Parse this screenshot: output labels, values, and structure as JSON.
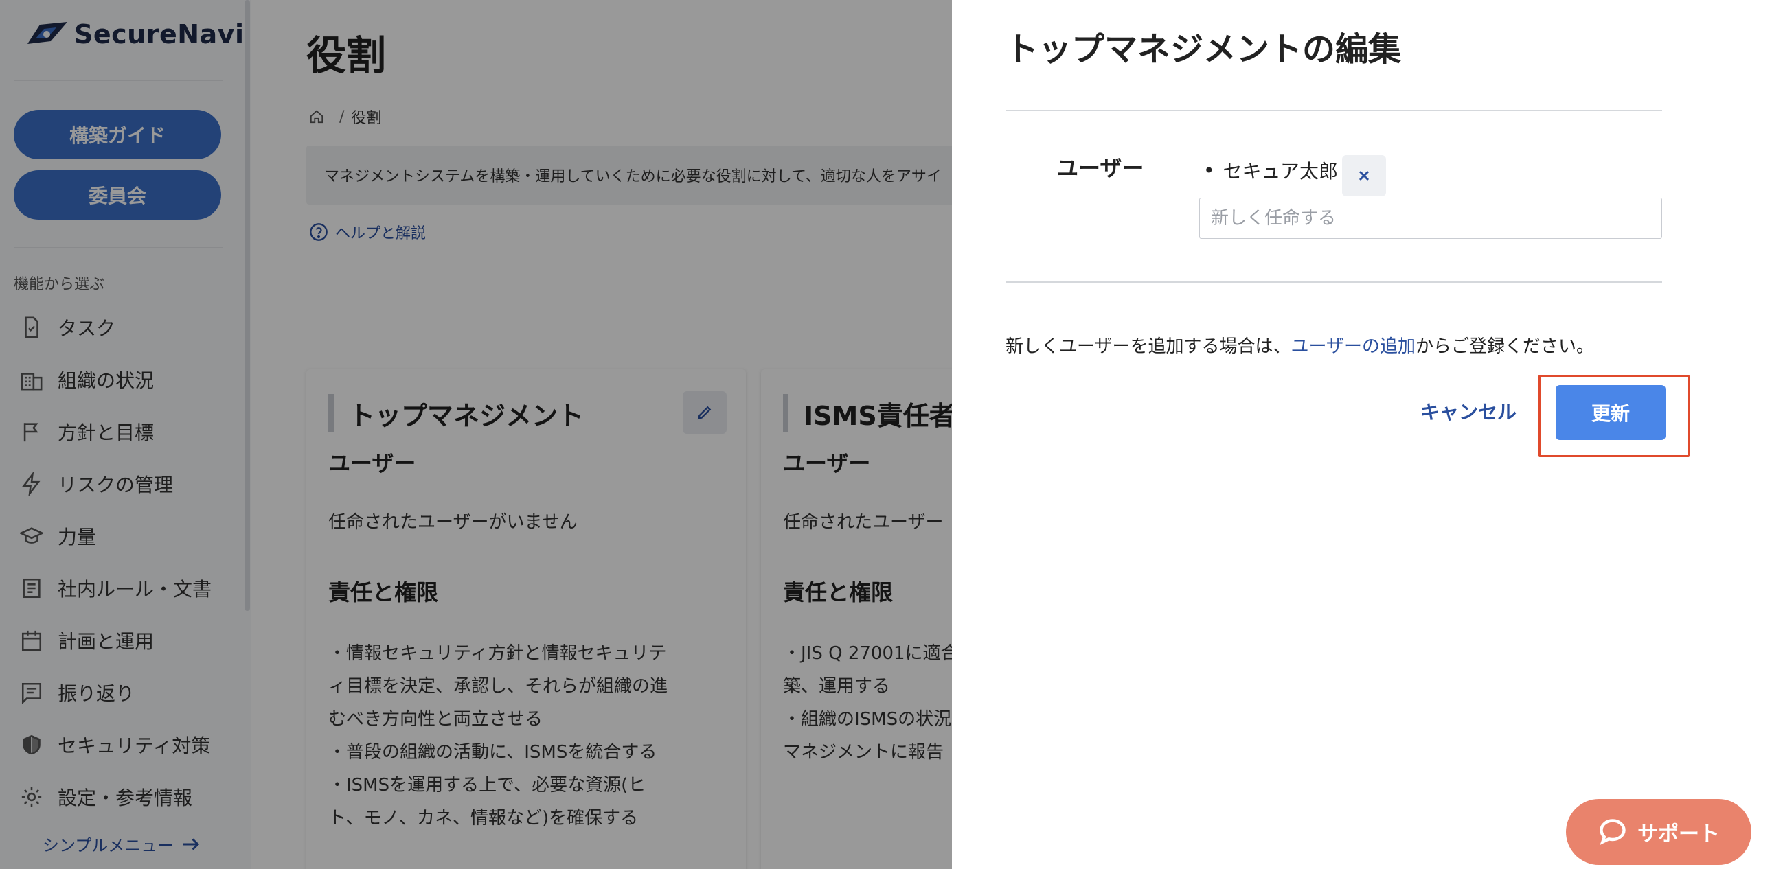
{
  "app": {
    "logo_text": "SecureNavi"
  },
  "sidebar": {
    "guide_button": "構築ガイド",
    "committee_button": "委員会",
    "section_label": "機能から選ぶ",
    "items": [
      {
        "label": "タスク",
        "icon": "task-icon"
      },
      {
        "label": "組織の状況",
        "icon": "building-icon"
      },
      {
        "label": "方針と目標",
        "icon": "flag-icon"
      },
      {
        "label": "リスクの管理",
        "icon": "lightning-icon"
      },
      {
        "label": "力量",
        "icon": "graduation-cap-icon"
      },
      {
        "label": "社内ルール・文書",
        "icon": "document-icon"
      },
      {
        "label": "計画と運用",
        "icon": "calendar-icon"
      },
      {
        "label": "振り返り",
        "icon": "review-icon"
      },
      {
        "label": "セキュリティ対策",
        "icon": "shield-icon"
      },
      {
        "label": "設定・参考情報",
        "icon": "gear-icon"
      }
    ],
    "simple_menu": "シンプルメニュー"
  },
  "main": {
    "title": "役割",
    "breadcrumb": {
      "current": "役割"
    },
    "info_text": "マネジメントシステムを構築・運用していくために必要な役割に対して、適切な人をアサイ",
    "help_link": "ヘルプと解説",
    "cards": [
      {
        "title": "トップマネジメント",
        "users_heading": "ユーザー",
        "users_empty": "任命されたユーザーがいません",
        "responsibility_heading": "責任と権限",
        "body": "・情報セキュリティ方針と情報セキュリティ目標を決定、承認し、それらが組織の進むべき方向性と両立させる\n・普段の組織の活動に、ISMSを統合する\n・ISMSを運用する上で、必要な資源(ヒト、モノ、カネ、情報など)を確保する"
      },
      {
        "title": "ISMS責任者",
        "users_heading": "ユーザー",
        "users_empty": "任命されたユーザー",
        "responsibility_heading": "責任と権限",
        "body": "・JIS Q 27001に適合\n築、運用する\n・組織のISMSの状況\nマネジメントに報告"
      }
    ]
  },
  "drawer": {
    "title": "トップマネジメントの編集",
    "users_label": "ユーザー",
    "assigned_users": [
      "セキュア太郎"
    ],
    "new_assign_placeholder": "新しく任命する",
    "note_before": "新しくユーザーを追加する場合は、",
    "note_link": "ユーザーの追加",
    "note_after": "からご登録ください。",
    "cancel_label": "キャンセル",
    "update_label": "更新"
  },
  "support": {
    "label": "サポート"
  },
  "colors": {
    "primary": "#3b6fc6",
    "update_button": "#4a86e8",
    "link": "#2a4f9e",
    "highlight_border": "#e04a2c",
    "support": "#e9836c"
  }
}
